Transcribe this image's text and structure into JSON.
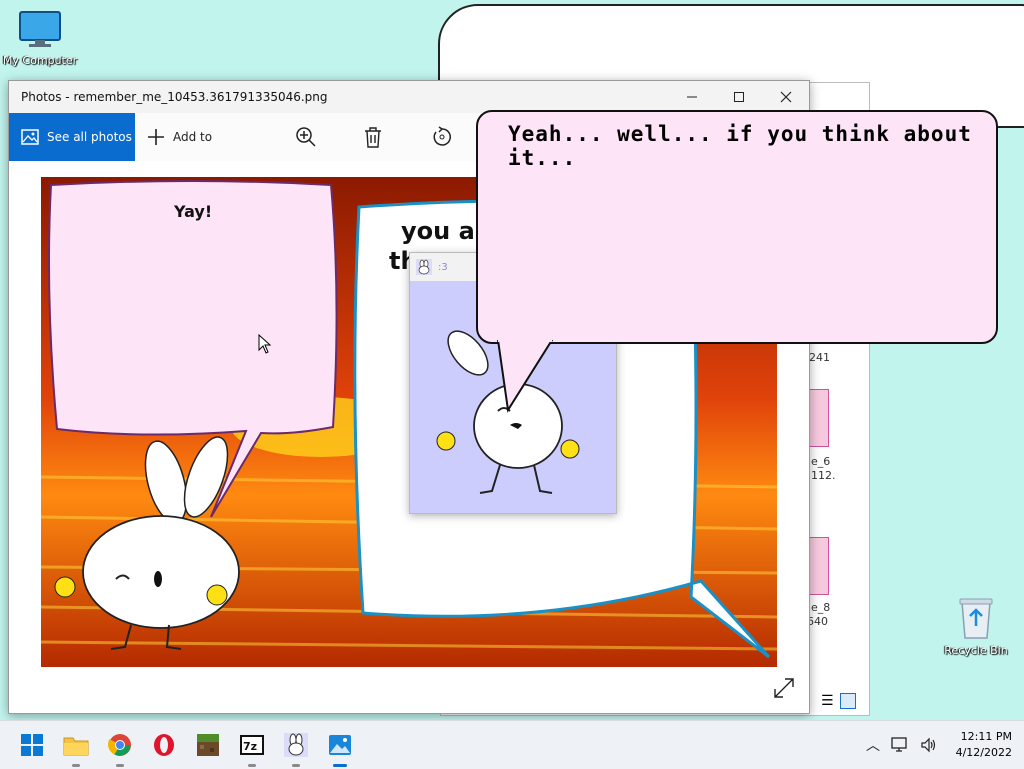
{
  "desktop": {
    "icons": [
      {
        "label": "My Computer",
        "icon": "monitor-icon"
      },
      {
        "label": "Recycle Bin",
        "icon": "recycle-bin-icon"
      }
    ]
  },
  "explorer": {
    "captions": [
      "241",
      "e_6",
      "112.",
      "e_8",
      "640"
    ]
  },
  "photos": {
    "title": "Photos - remember_me_10453.361791335046.png",
    "toolbar": {
      "see_all": "See all photos",
      "add_to": "Add to"
    },
    "image": {
      "bubble_left_text": "Yay!",
      "bubble_right_text_1": "you ar",
      "bubble_right_text_2": "th"
    }
  },
  "mini_window": {
    "title": ":3"
  },
  "speech_bubble": {
    "text": "Yeah... well... if you think about it..."
  },
  "taskbar": {
    "apps": [
      "start-icon",
      "file-explorer-icon",
      "chrome-icon",
      "opera-icon",
      "minecraft-icon",
      "7zip-icon",
      "bunny-app-icon",
      "photos-icon"
    ],
    "clock": {
      "time": "12:11 PM",
      "date": "4/12/2022"
    }
  },
  "colors": {
    "accent": "#0a6ccf",
    "speech_bg": "#fde4f7",
    "bubble_pink": "#fde4f7",
    "mini_bg": "#cccdfc",
    "lava_dark": "#7a1400",
    "lava_light": "#ff9a1a"
  }
}
